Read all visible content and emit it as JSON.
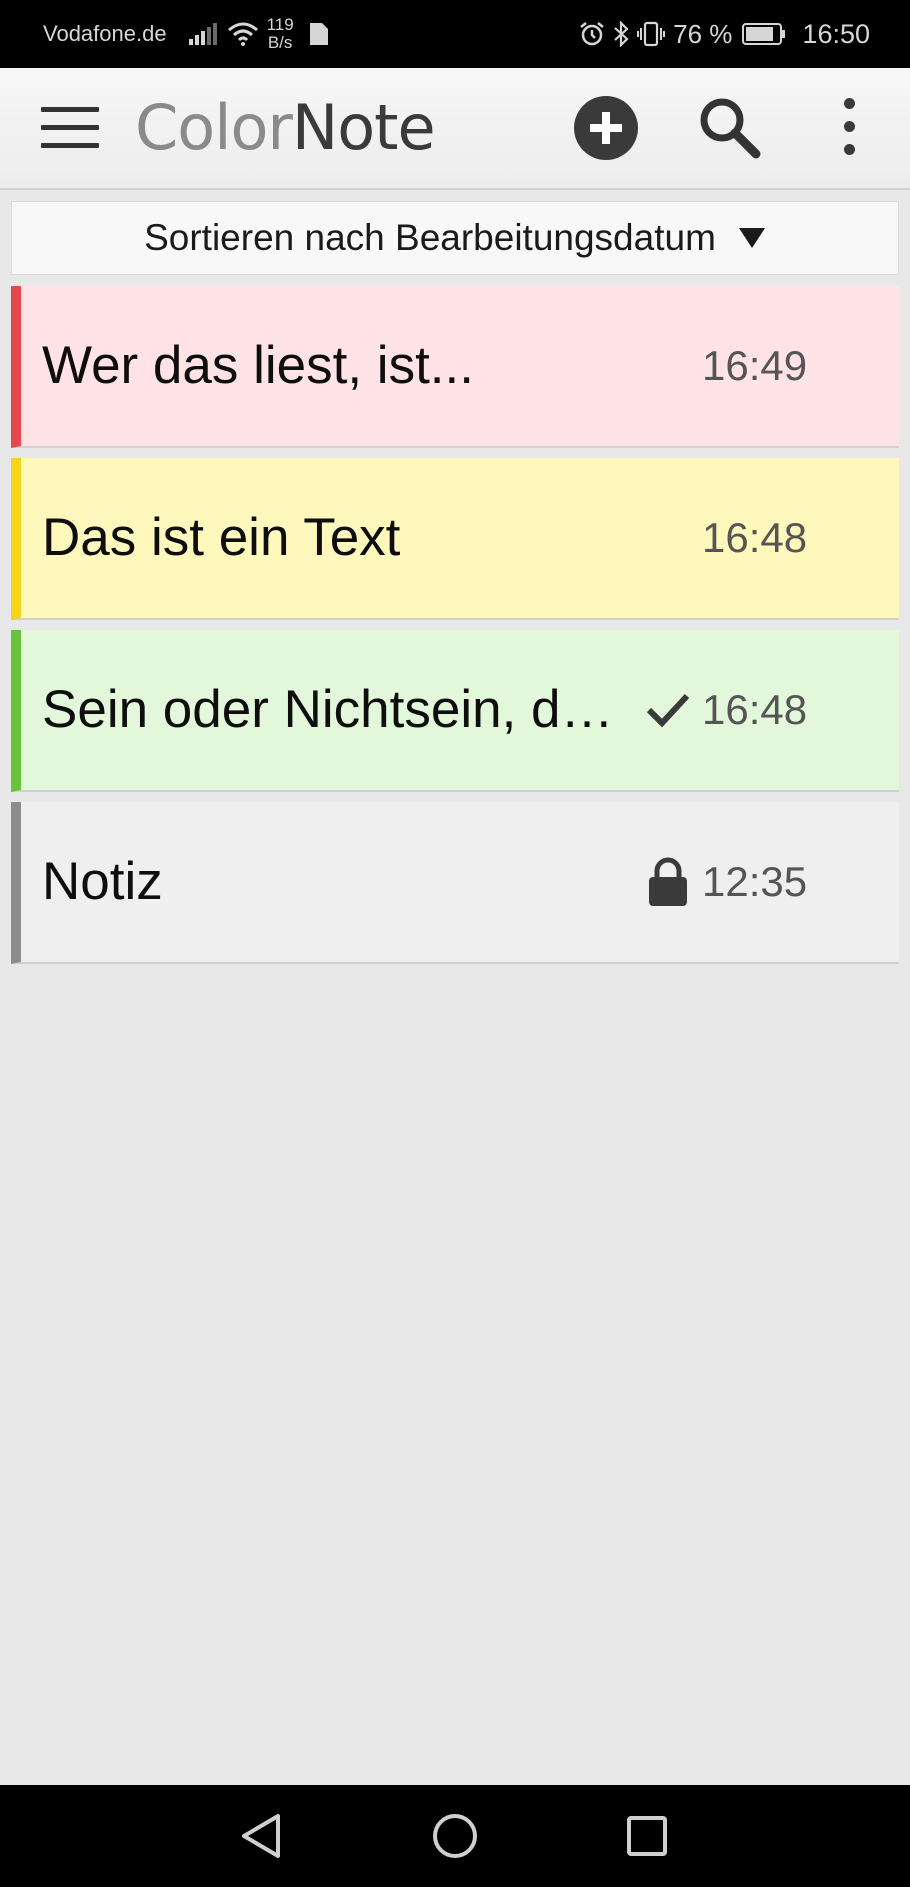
{
  "status_bar": {
    "carrier": "Vodafone.de",
    "speed_value": "119",
    "speed_unit": "B/s",
    "battery": "76 %",
    "time": "16:50"
  },
  "app_bar": {
    "logo_part1": "Color",
    "logo_part2": "Note"
  },
  "sort": {
    "label": "Sortieren nach Bearbeitungsdatum"
  },
  "notes": [
    {
      "title": "Wer das liest, ist...",
      "time": "16:49",
      "color": "#e5474f",
      "bg": "#ffe3e6",
      "icon": ""
    },
    {
      "title": "Das ist ein Text",
      "time": "16:48",
      "color": "#f6d619",
      "bg": "#fff8bd",
      "icon": ""
    },
    {
      "title": "Sein oder Nichtsein, d…",
      "time": "16:48",
      "color": "#66c23a",
      "bg": "#e3f8da",
      "icon": "check-icon"
    },
    {
      "title": "Notiz",
      "time": "12:35",
      "color": "#8c8c8c",
      "bg": "#efefef",
      "icon": "lock-icon"
    }
  ]
}
